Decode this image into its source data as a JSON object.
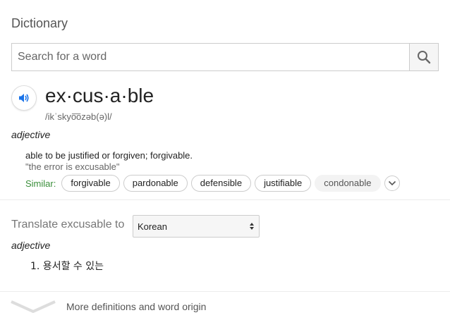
{
  "header": {
    "title": "Dictionary"
  },
  "search": {
    "placeholder": "Search for a word",
    "value": ""
  },
  "entry": {
    "headword": "ex·cus·a·ble",
    "phonetic": "/ikˈskyo͞ozəb(ə)l/",
    "part_of_speech": "adjective",
    "definition": "able to be justified or forgiven; forgivable.",
    "example": "\"the error is excusable\"",
    "similar_label": "Similar:",
    "similar": [
      "forgivable",
      "pardonable",
      "defensible",
      "justifiable",
      "condonable"
    ]
  },
  "translate": {
    "label": "Translate excusable to",
    "language": "Korean",
    "part_of_speech": "adjective",
    "items": [
      "1. 용서할 수 있는"
    ]
  },
  "footer": {
    "more_label": "More definitions and word origin"
  },
  "colors": {
    "similar_green": "#3a8e3a",
    "speaker_blue": "#1a73e8"
  }
}
